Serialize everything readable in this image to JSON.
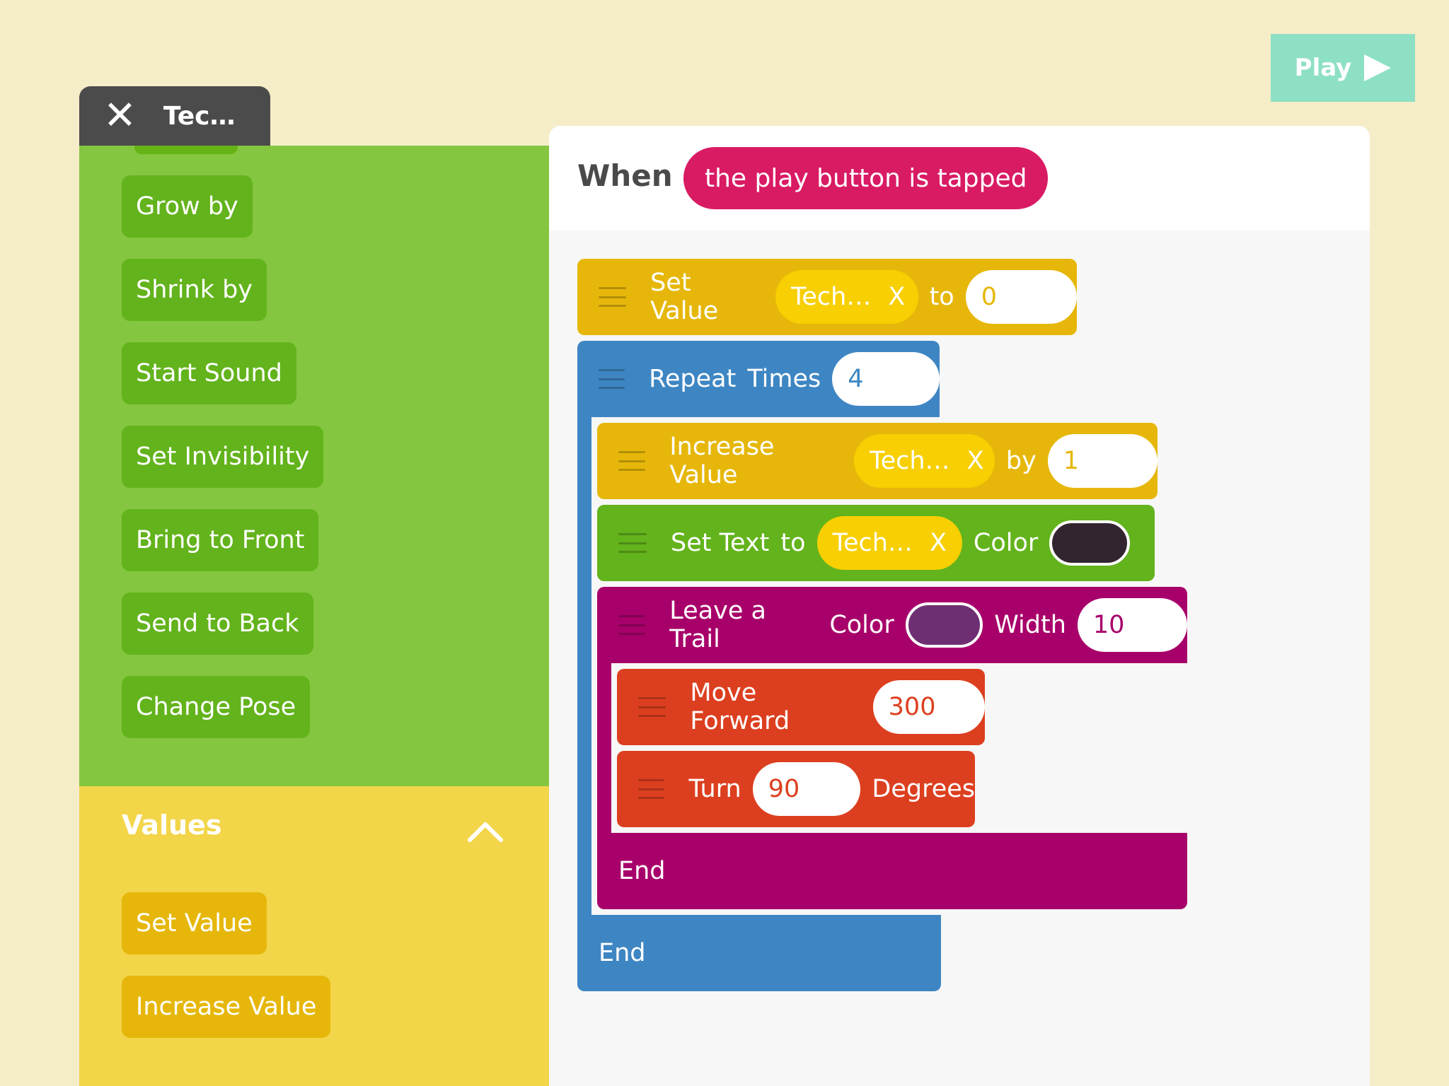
{
  "play_button": {
    "label": "Play"
  },
  "palette": {
    "tab_close": "✕",
    "tab_title": "Tec…",
    "green_items": [
      "Grow by",
      "Shrink by",
      "Start Sound",
      "Set Invisibility",
      "Bring to Front",
      "Send to Back",
      "Change Pose"
    ],
    "values_section": {
      "title": "Values",
      "items": [
        "Set Value",
        "Increase Value"
      ]
    }
  },
  "script": {
    "when_label": "When",
    "trigger": "the play button is tapped",
    "set_value": {
      "label": "Set Value",
      "var": "Tech…",
      "var_x": "X",
      "to": "to",
      "value": "0"
    },
    "repeat": {
      "label": "Repeat",
      "times": "Times",
      "value": "4",
      "end": "End"
    },
    "increase": {
      "label": "Increase Value",
      "var": "Tech…",
      "var_x": "X",
      "by": "by",
      "value": "1"
    },
    "set_text": {
      "label": "Set Text",
      "to": "to",
      "var": "Tech…",
      "var_x": "X",
      "color_label": "Color",
      "color": "#33252f"
    },
    "trail": {
      "label": "Leave a Trail",
      "color_label": "Color",
      "color": "#6d2f72",
      "width_label": "Width",
      "width": "10",
      "end": "End"
    },
    "move": {
      "label": "Move Forward",
      "value": "300"
    },
    "turn": {
      "label": "Turn",
      "value": "90",
      "unit": "Degrees"
    }
  },
  "colors": {
    "value_block": "#e6b70a",
    "control_block": "#3e86c3",
    "looks_block": "#63b31c",
    "pen_block": "#a8006a",
    "motion_block": "#dc3f1f",
    "trigger": "#d91b64",
    "play": "#8ee0c4"
  }
}
